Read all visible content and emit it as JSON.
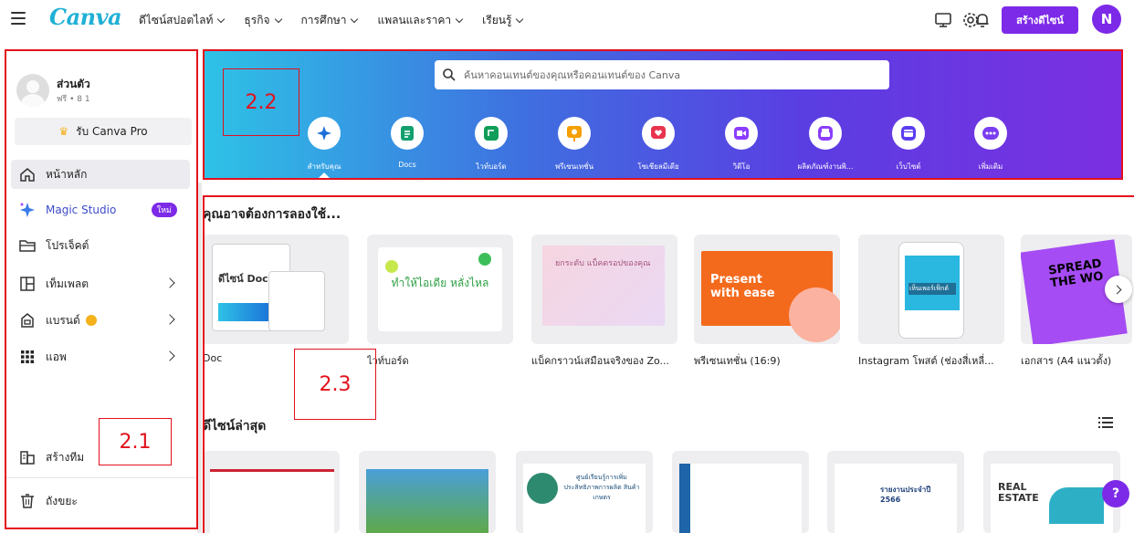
{
  "app": {
    "logo": "Canva",
    "nav": [
      "ดีไซน์สปอตไลท์",
      "ธุรกิจ",
      "การศึกษา",
      "แพลนและราคา",
      "เรียนรู้"
    ],
    "create_label": "สร้างดีไซน์",
    "avatar_letter": "N",
    "colors": {
      "accent": "#7d2ae8",
      "annotation": "#e3101d",
      "logo": "#1fb0d6"
    }
  },
  "sidebar": {
    "profile_name": "ส่วนตัว",
    "profile_sub": "ฟรี • 8 1",
    "pro_label": "รับ Canva Pro",
    "items": [
      {
        "label": "หน้าหลัก",
        "icon": "home-icon"
      },
      {
        "label": "Magic Studio",
        "icon": "magic-sparkle-icon",
        "badge": "ใหม่"
      },
      {
        "label": "โปรเจ็คต์",
        "icon": "folder-icon"
      },
      {
        "label": "เท็มเพลต",
        "icon": "template-icon"
      },
      {
        "label": "แบรนด์",
        "icon": "brand-icon"
      },
      {
        "label": "แอพ",
        "icon": "apps-grid-icon"
      }
    ],
    "bottom_items": [
      {
        "label": "สร้างทีม",
        "icon": "team-icon"
      },
      {
        "label": "ถังขยะ",
        "icon": "trash-icon"
      }
    ]
  },
  "hero": {
    "search_placeholder": "ค้นหาคอนเทนต์ของคุณหรือคอนเทนต์ของ Canva",
    "categories": [
      {
        "label": "สำหรับคุณ",
        "icon": "sparkle-icon",
        "color": "#1b6fd8"
      },
      {
        "label": "Docs",
        "icon": "docs-icon",
        "color": "#12a06e"
      },
      {
        "label": "ไวท์บอร์ด",
        "icon": "whiteboard-icon",
        "color": "#0f9d58"
      },
      {
        "label": "พรีเซนเทชั่น",
        "icon": "presentation-icon",
        "color": "#f59f00"
      },
      {
        "label": "โซเชียลมีเดีย",
        "icon": "social-heart-icon",
        "color": "#e8344e"
      },
      {
        "label": "วิดีโอ",
        "icon": "video-icon",
        "color": "#8b3dff"
      },
      {
        "label": "ผลิตภัณฑ์งานพิ...",
        "icon": "print-icon",
        "color": "#8b3dff"
      },
      {
        "label": "เว็บไซต์",
        "icon": "website-icon",
        "color": "#5b3df0"
      },
      {
        "label": "เพิ่มเติม",
        "icon": "more-icon",
        "color": "#7a3df0"
      }
    ]
  },
  "suggest": {
    "title": "คุณอาจต้องการลองใช้...",
    "cards": [
      {
        "label": "Doc",
        "text": "ดีไซน์ Docs"
      },
      {
        "label": "ไวท์บอร์ด",
        "text": "ทำให้ไอเดีย หลั่งไหล"
      },
      {
        "label": "แบ็คกราวน์เสมือนจริงของ Zo...",
        "text": "ยกระดับ แบ็คดรอปของคุณ"
      },
      {
        "label": "พรีเซนเทชั่น (16:9)",
        "text": "Present with ease"
      },
      {
        "label": "Instagram โพสต์ (ช่องสี่เหลี่...",
        "text": "เห็นเพอร์เฟ็กต์"
      },
      {
        "label": "เอกสาร (A4 แนวตั้ง)",
        "text": "SPREAD THE WO"
      }
    ]
  },
  "recent": {
    "title": "ดีไซน์ล่าสุด",
    "thumbs": [
      "",
      "",
      "ศูนย์เรียนรู้การเพิ่ม ประสิทธิภาพการผลิต สินค้าเกษตร",
      "",
      "รายงานประจำปี 2566",
      "REAL ESTATE"
    ]
  },
  "annotations": [
    "2.1",
    "2.2",
    "2.3"
  ],
  "help": "?"
}
